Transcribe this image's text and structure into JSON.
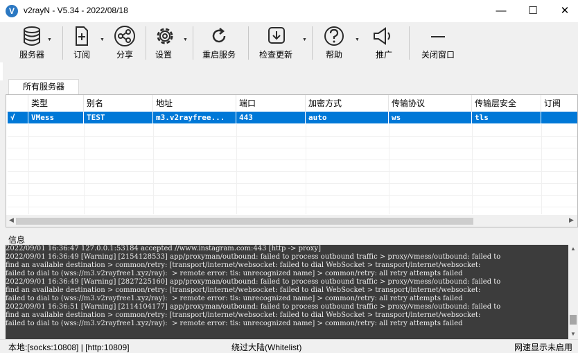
{
  "window": {
    "title": "v2rayN - V5.34 - 2022/08/18",
    "icon_glyph": "V",
    "minimize_glyph": "—",
    "maximize_glyph": "☐",
    "close_glyph": "✕"
  },
  "toolbar": {
    "servers": "服务器",
    "subscribe": "订阅",
    "share": "分享",
    "settings": "设置",
    "restart": "重启服务",
    "check_update": "检查更新",
    "help": "帮助",
    "promote": "推广",
    "close_window": "关闭窗口",
    "dropdown_glyph": "▼"
  },
  "tabs": [
    "所有服务器"
  ],
  "server_list": {
    "columns": [
      "类型",
      "别名",
      "地址",
      "端口",
      "加密方式",
      "传输协议",
      "传输层安全",
      "订阅"
    ],
    "rows": [
      {
        "active": "√",
        "type": "VMess",
        "alias": "TEST",
        "address": "m3.v2rayfree...",
        "port": "443",
        "security": "auto",
        "network": "ws",
        "tls": "tls",
        "sub": ""
      }
    ]
  },
  "scroll_glyphs": {
    "left": "◀",
    "right": "▶",
    "up": "▲",
    "down": "▼"
  },
  "info_label": "信息",
  "log": "2022/09/01 16:36:47 127.0.0.1:53184 accepted //www.instagram.com:443 [http -> proxy]\n2022/09/01 16:36:49 [Warning] [2154128533] app/proxyman/outbound: failed to process outbound traffic > proxy/vmess/outbound: failed to\nfind an available destination > common/retry: [transport/internet/websocket: failed to dial WebSocket > transport/internet/websocket:\nfailed to dial to (wss://m3.v2rayfree1.xyz/ray):  > remote error: tls: unrecognized name] > common/retry: all retry attempts failed\n2022/09/01 16:36:49 [Warning] [2827225160] app/proxyman/outbound: failed to process outbound traffic > proxy/vmess/outbound: failed to\nfind an available destination > common/retry: [transport/internet/websocket: failed to dial WebSocket > transport/internet/websocket:\nfailed to dial to (wss://m3.v2rayfree1.xyz/ray):  > remote error: tls: unrecognized name] > common/retry: all retry attempts failed\n2022/09/01 16:36:51 [Warning] [2114104177] app/proxyman/outbound: failed to process outbound traffic > proxy/vmess/outbound: failed to\nfind an available destination > common/retry: [transport/internet/websocket: failed to dial WebSocket > transport/internet/websocket:\nfailed to dial to (wss://m3.v2rayfree1.xyz/ray):  > remote error: tls: unrecognized name] > common/retry: all retry attempts failed",
  "status": {
    "local": "本地:[socks:10808] | [http:10809]",
    "routing": "绕过大陆(Whitelist)",
    "speed": "网速显示未启用"
  },
  "colors": {
    "selection": "#0078d7",
    "log_background": "#3c3c3c",
    "toolbar_icon": "#2b2b2b"
  }
}
